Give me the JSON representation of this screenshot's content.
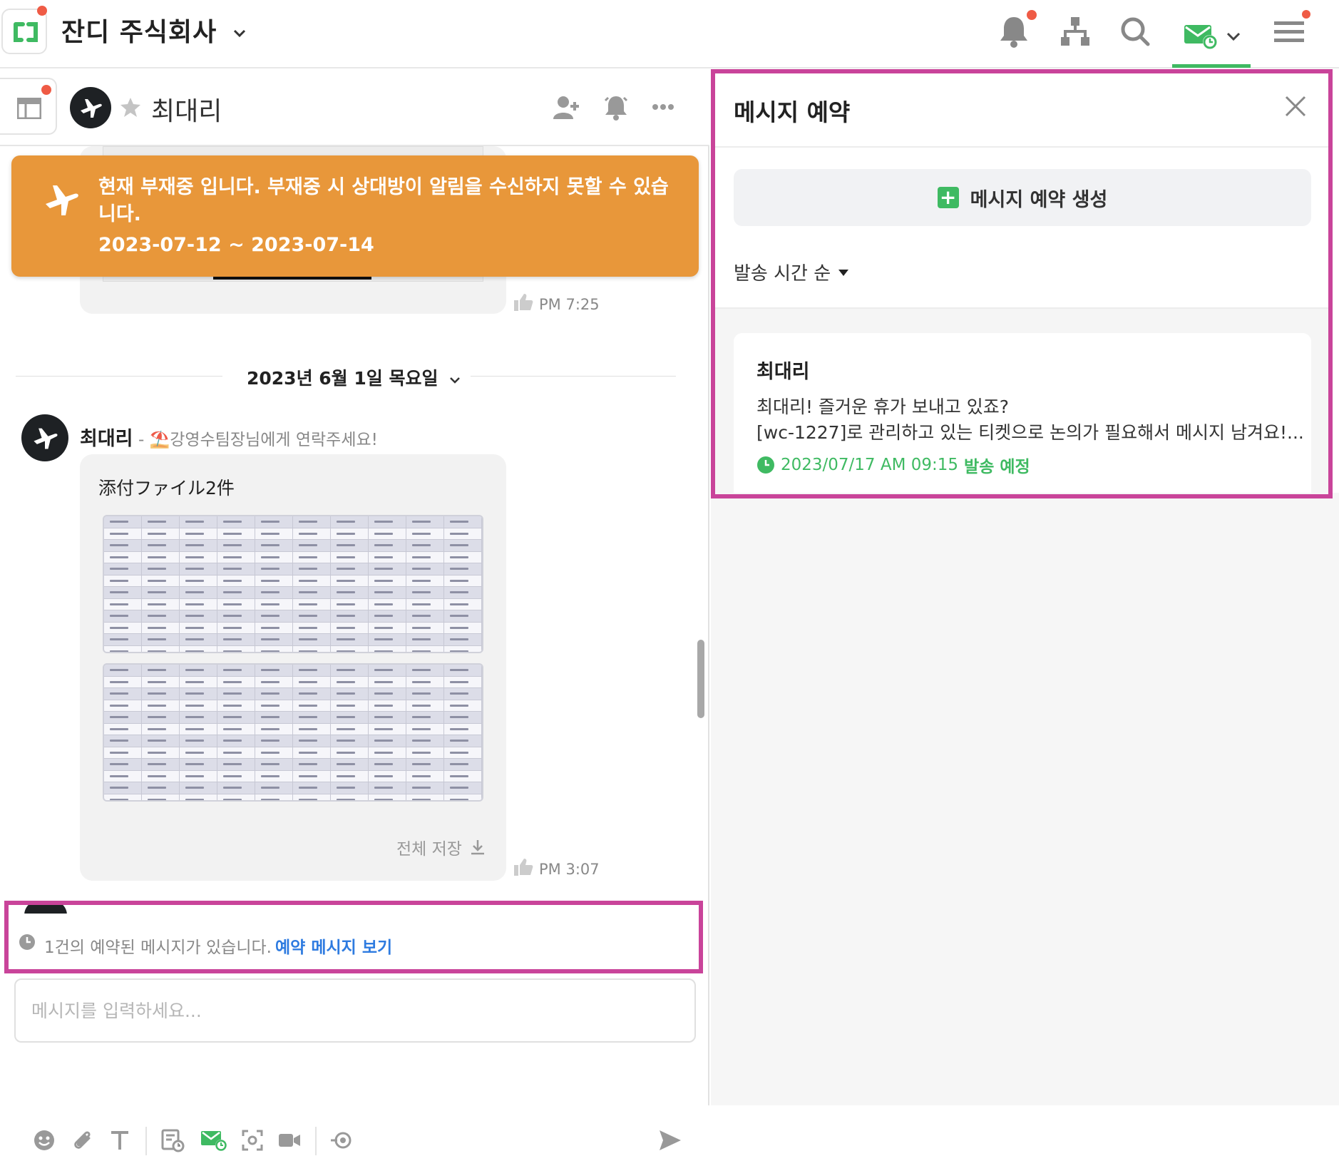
{
  "topbar": {
    "workspace_name": "잔디 주식회사",
    "icons": [
      "bell-icon",
      "org-chart-icon",
      "search-icon",
      "scheduled-mail-icon",
      "menu-icon"
    ]
  },
  "chat": {
    "room_name": "최대리",
    "away_banner": {
      "message": "현재 부재중 입니다. 부재중 시 상대방이 알림을 수신하지 못할 수 있습니다.",
      "dates": "2023-07-12 ~ 2023-07-14"
    },
    "first_message_time": "PM 7:25",
    "date_divider": "2023년 6월 1일 목요일",
    "message": {
      "sender": "최대리",
      "status": "- ⛱️강영수팀장님에게 연락주세요!",
      "attachment_title": "添付ファイル2件",
      "save_all": "전체 저장",
      "time": "PM 3:07"
    },
    "reserved_notice": {
      "text": "1건의 예약된 메시지가 있습니다.",
      "link": "예약 메시지 보기"
    },
    "input": {
      "placeholder": "메시지를 입력하세요..."
    }
  },
  "panel": {
    "title": "메시지 예약",
    "create_button": "메시지 예약 생성",
    "sort": "발송 시간 순",
    "card": {
      "recipient": "최대리",
      "line1": "최대리! 즐거운 휴가 보내고 있죠?",
      "line2": "[wc-1227]로 관리하고 있는 티켓으로 논의가 필요해서 메시지 남겨요!...",
      "datetime": "2023/07/17 AM 09:15",
      "status": "발송 예정"
    }
  },
  "colors": {
    "accent_green": "#3fba62",
    "away_orange": "#e8973a",
    "highlight_magenta": "#c9449a",
    "link_blue": "#2e7be0",
    "notification_red": "#ef5b45"
  }
}
